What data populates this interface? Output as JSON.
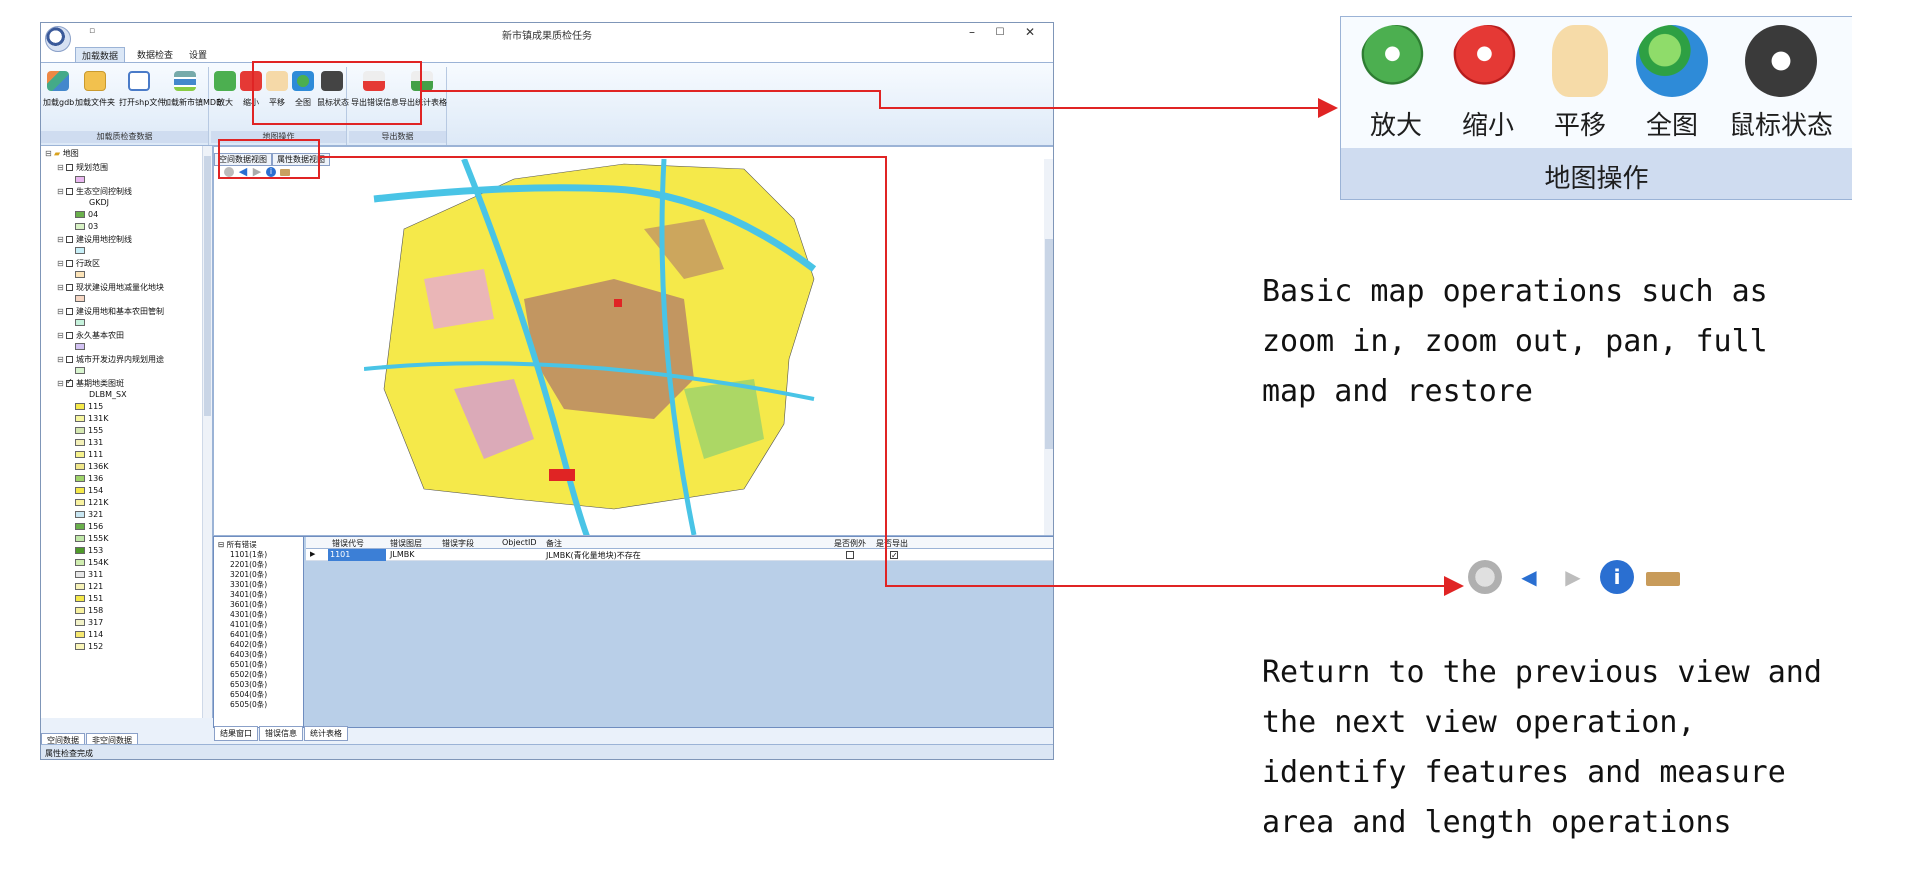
{
  "window": {
    "title": "新市镇成果质检任务",
    "controls": [
      "–",
      "☐",
      "✕"
    ]
  },
  "ribbon": {
    "tabs": [
      "加载数据",
      "数据检查",
      "设置"
    ],
    "groups": {
      "load": {
        "label": "加载质检查数据",
        "buttons": [
          "加载gdb",
          "加载文件夹",
          "打开shp文件",
          "加载新市镇MDB"
        ]
      },
      "map_ops": {
        "label": "地图操作",
        "buttons": [
          "放大",
          "缩小",
          "平移",
          "全图",
          "鼠标状态"
        ]
      },
      "export": {
        "label": "导出数据",
        "buttons": [
          "导出错误信息",
          "导出统计表格"
        ]
      }
    }
  },
  "layer_tree": {
    "root": "地图",
    "layers": [
      {
        "name": "规划范围"
      },
      {
        "name": "生态空间控制线",
        "sub": "GKDJ",
        "legend": [
          "04",
          "03"
        ]
      },
      {
        "name": "建设用地控制线"
      },
      {
        "name": "行政区"
      },
      {
        "name": "现状建设用地减量化地块"
      },
      {
        "name": "建设用地和基本农田管制"
      },
      {
        "name": "永久基本农田"
      },
      {
        "name": "城市开发边界内规划用途"
      },
      {
        "name": "基期地类图斑",
        "checked": true,
        "sub": "DLBM_SX"
      }
    ],
    "dlbm_codes": [
      "115",
      "131K",
      "155",
      "131",
      "111",
      "136K",
      "136",
      "154",
      "121K",
      "321",
      "156",
      "155K",
      "153",
      "154K",
      "311",
      "121",
      "151",
      "158",
      "317",
      "114",
      "152"
    ],
    "bottom_tabs": [
      "空间数据",
      "非空间数据"
    ]
  },
  "map": {
    "tabs": [
      "空间数据视图",
      "属性数据视图"
    ],
    "tool_icons": [
      "back-icon",
      "prev-icon",
      "next-icon",
      "identify-icon",
      "measure-icon"
    ]
  },
  "results": {
    "tree_root": "所有错误",
    "tree_items": [
      "1101(1条)",
      "2201(0条)",
      "3201(0条)",
      "3301(0条)",
      "3401(0条)",
      "3601(0条)",
      "4301(0条)",
      "4101(0条)",
      "6401(0条)",
      "6402(0条)",
      "6403(0条)",
      "6501(0条)",
      "6502(0条)",
      "6503(0条)",
      "6504(0条)",
      "6505(0条)"
    ],
    "columns": [
      "错误代号",
      "错误图层",
      "错误字段",
      "ObjectID",
      "备注",
      "是否例外",
      "是否导出"
    ],
    "rows": [
      {
        "code": "1101",
        "layer": "JLMBK",
        "field": "",
        "objectid": "",
        "note": "JLMBK(青化量地块)不存在",
        "exception": false,
        "export": true
      }
    ],
    "tabs": [
      "结果窗口",
      "错误信息",
      "统计表格"
    ]
  },
  "status": "属性检查完成",
  "zoom_panel": {
    "buttons": [
      "放大",
      "缩小",
      "平移",
      "全图",
      "鼠标状态"
    ],
    "group_label": "地图操作"
  },
  "captions": {
    "map_ops": "Basic map operations such as\nzoom in, zoom out, pan, full\nmap and restore",
    "nav_ops": "Return to the previous view and\nthe next view operation,\nidentify features and measure\narea and length operations"
  },
  "colors": {
    "annotation_red": "#e02424",
    "ribbon_blue": "#dde9f7",
    "map_yellow": "#f5e94a",
    "map_brown": "#b07a6a"
  }
}
